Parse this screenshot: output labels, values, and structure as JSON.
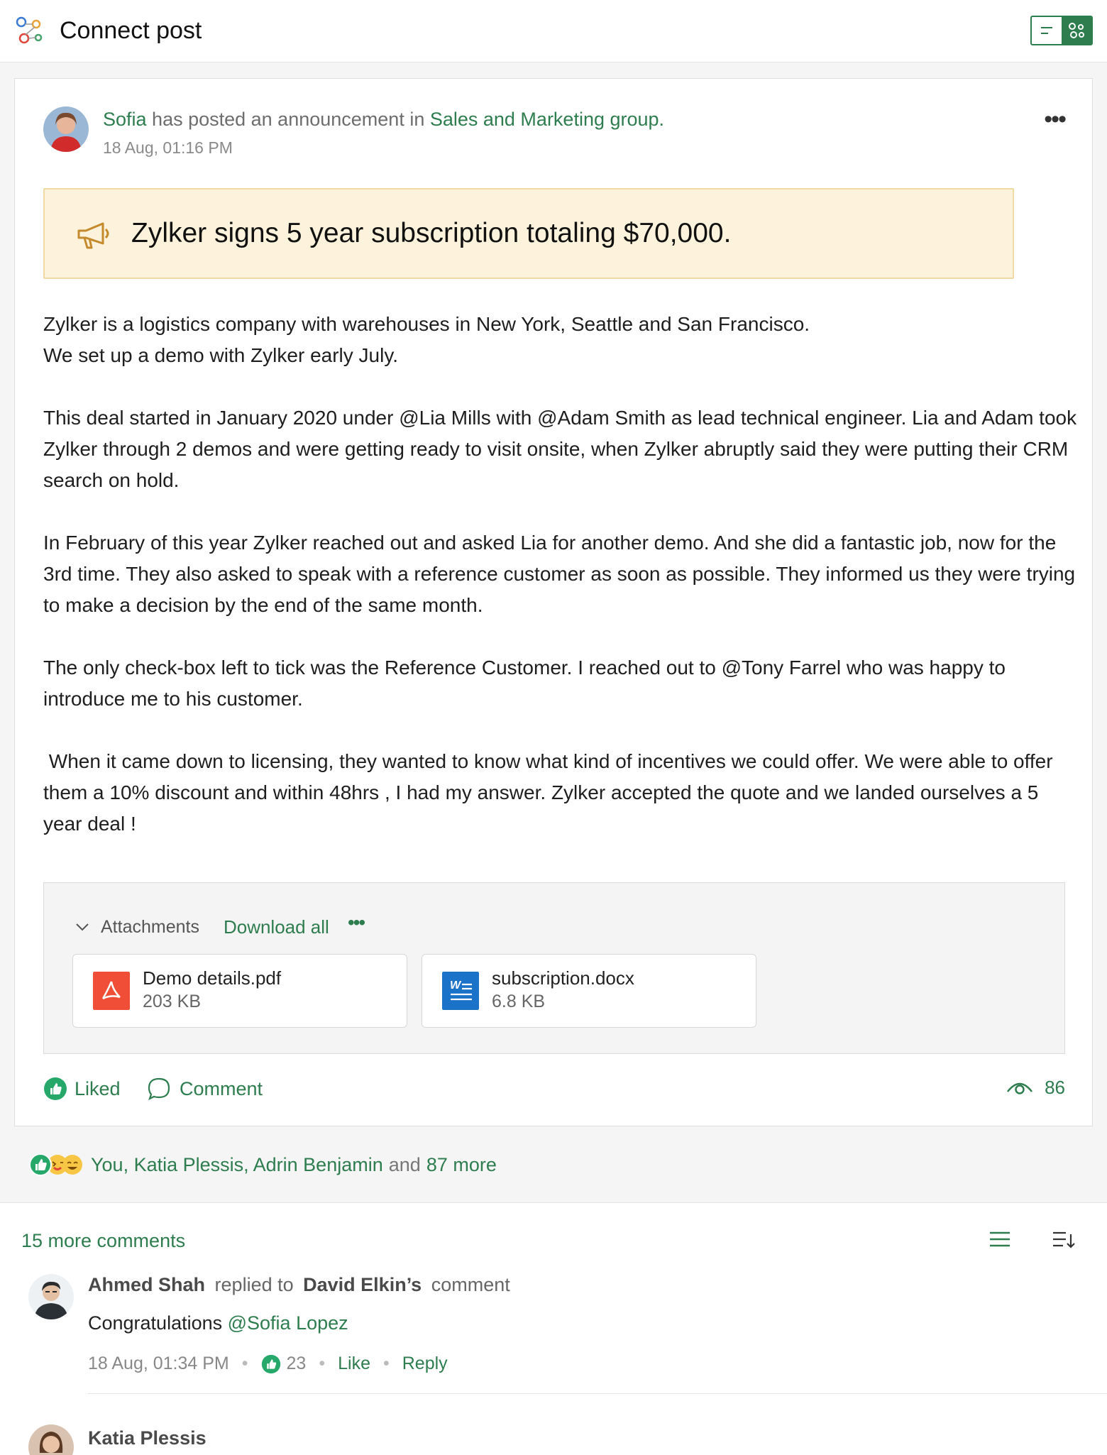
{
  "app": {
    "title": "Connect post"
  },
  "post": {
    "author": "Sofia",
    "action_text": " has posted an announcement in ",
    "group": "Sales and Marketing group.",
    "time": "18 Aug, 01:16 PM",
    "announcement_title": "Zylker signs 5 year subscription totaling $70,000.",
    "paragraphs": [
      "Zylker is a logistics company with warehouses in New York, Seattle and San Francisco.\nWe set up a demo with Zylker early July.",
      "This deal started in January 2020 under @Lia Mills with @Adam Smith as lead technical engineer. Lia and Adam took Zylker through 2 demos and were getting ready to visit onsite, when Zylker abruptly said they were putting their CRM search on hold.",
      "In February of this year Zylker reached out and asked Lia for another demo. And she did a fantastic job, now for the 3rd time. They also asked to speak with a reference customer as soon as possible. They informed us they were trying to make a decision by the end of the same month.",
      "The only check-box left to tick was the Reference Customer. I reached out to @Tony Farrel who was happy to introduce me to his customer.",
      " When it came down to licensing, they wanted to know what kind of incentives we could offer. We were able to offer them a 10% discount and within 48hrs , I had my answer. Zylker accepted the quote and we landed ourselves a 5 year deal !"
    ],
    "attachments": {
      "label": "Attachments",
      "download_all": "Download all",
      "files": [
        {
          "name": "Demo details.pdf",
          "size": "203 KB",
          "icon": "pdf-file-icon",
          "color": "#f04e37"
        },
        {
          "name": "subscription.docx",
          "size": "6.8 KB",
          "icon": "word-file-icon",
          "color": "#1a73c9"
        }
      ]
    },
    "actions": {
      "liked": "Liked",
      "comment": "Comment",
      "views": "86"
    },
    "reactions": {
      "names": "You, Katia Plessis, Adrin Benjamin",
      "and": "and",
      "more": "87 more"
    }
  },
  "comments": {
    "more_label": "15 more comments",
    "items": [
      {
        "author": "Ahmed Shah",
        "relation": "replied to",
        "target": "David Elkin’s",
        "target_suffix": "comment",
        "text": "Congratulations ",
        "mention": "@Sofia Lopez",
        "time": "18 Aug, 01:34 PM",
        "likes": "23",
        "like_label": "Like",
        "reply_label": "Reply"
      },
      {
        "author": "Katia Plessis"
      }
    ]
  },
  "colors": {
    "accent": "#2e7d4f",
    "announce_bg": "#fdf3dc",
    "announce_border": "#f0d9a2"
  }
}
